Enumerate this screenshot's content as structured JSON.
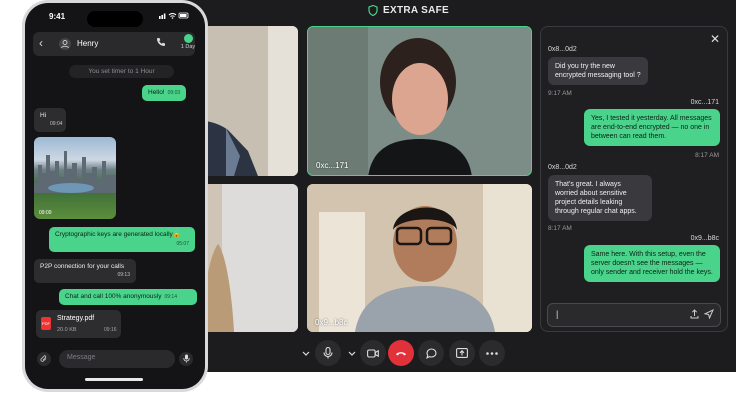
{
  "app": {
    "name": "EXTRA SAFE"
  },
  "video": {
    "tiles": [
      {
        "label": ""
      },
      {
        "label": "0xc...171"
      },
      {
        "label": ""
      },
      {
        "label": "0x9...b8c"
      }
    ]
  },
  "controls": {
    "mic": "mic-icon",
    "camera": "camera-icon",
    "end": "end-call-icon",
    "chat": "chat-icon",
    "share": "share-screen-icon",
    "more": "more-icon"
  },
  "chat": {
    "close": "✕",
    "messages": [
      {
        "sender": "0x8...0d2",
        "text": "Did you try the new encrypted messaging tool ?",
        "time": "9:17 AM",
        "dir": "in"
      },
      {
        "sender": "0xc...171",
        "text": "Yes, I tested it yesterday. All messages are end-to-end encrypted — no one in between can read them.",
        "time": "8:17 AM",
        "dir": "out"
      },
      {
        "sender": "0x8...0d2",
        "text": "That's great. I always worried about sensitive project details leaking through regular chat apps.",
        "time": "8:17 AM",
        "dir": "in"
      },
      {
        "sender": "0x9...b8c",
        "text": "Same here. With this setup, even the server doesn't see the messages — only sender and receiver hold the keys.",
        "time": "8:17 AM",
        "dir": "out"
      }
    ],
    "composer_value": "|"
  },
  "phone": {
    "time": "9:41",
    "contact": "Henry",
    "timer_label": "1 Day",
    "system_note": "You set timer to 1 Hour",
    "messages": [
      {
        "text": "Hello!",
        "time": "09:03",
        "dir": "out"
      },
      {
        "text": "Hi",
        "time": "09:04",
        "dir": "in"
      },
      {
        "text": "Cryptographic keys are generated locally🔒",
        "time": "05:07",
        "dir": "out"
      },
      {
        "text": "P2P connection for your calls",
        "time": "09:13",
        "dir": "in"
      },
      {
        "text": "Chat and call 100% anonymously",
        "time": "09:14",
        "dir": "out"
      }
    ],
    "image_time": "09:09",
    "file": {
      "name": "Strategy.pdf",
      "size": "20.0 KB",
      "time": "09:16",
      "type": "PDF"
    },
    "input_placeholder": "Message"
  },
  "colors": {
    "accent": "#4ad38a",
    "danger": "#e1313a",
    "bg": "#1c1c1e"
  }
}
